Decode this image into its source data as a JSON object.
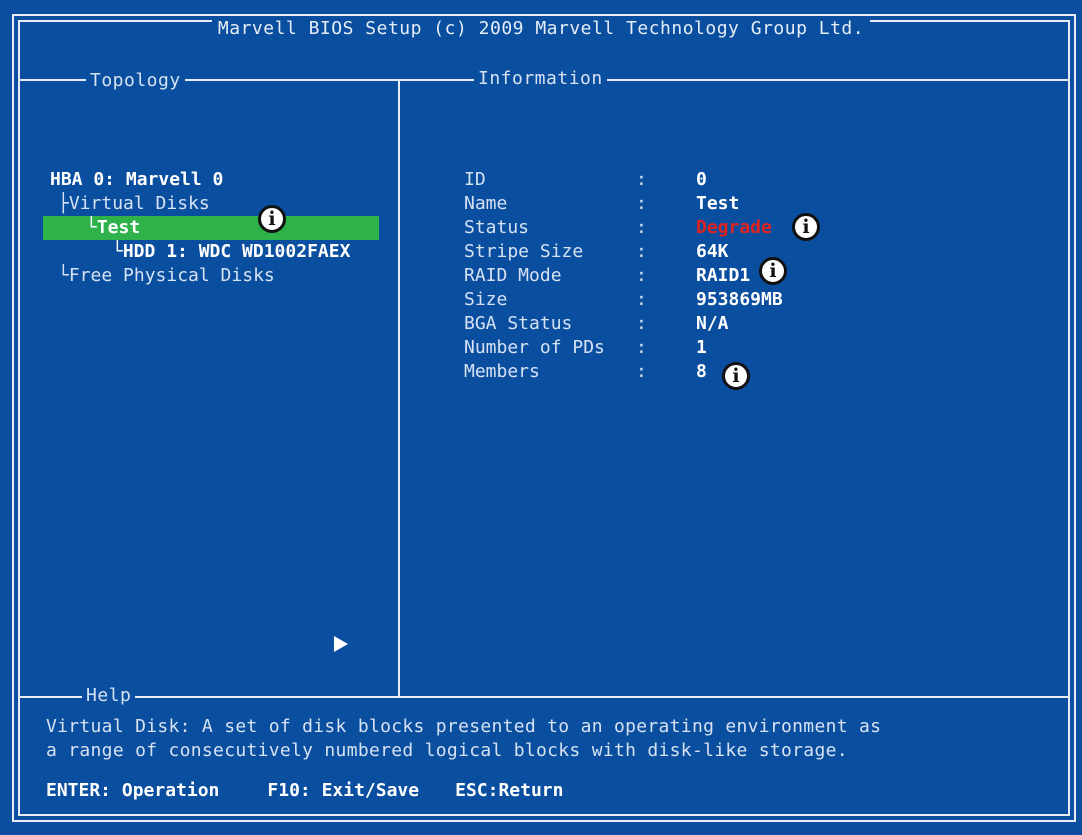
{
  "title": "Marvell BIOS Setup (c) 2009 Marvell Technology Group Ltd.",
  "panels": {
    "topology_label": "Topology",
    "information_label": "Information",
    "help_label": "Help"
  },
  "topology": {
    "hba": "HBA 0: Marvell 0",
    "virtual_disks": "Virtual Disks",
    "selected_vd": "Test",
    "hdd": "HDD 1: WDC WD1002FAEX",
    "free_disks": "Free Physical Disks",
    "selected_color": "#2fb24a"
  },
  "information": {
    "rows": [
      {
        "key": "ID",
        "value": "0"
      },
      {
        "key": "Name",
        "value": "Test"
      },
      {
        "key": "Status",
        "value": "Degrade"
      },
      {
        "key": "Stripe Size",
        "value": "64K"
      },
      {
        "key": "RAID Mode",
        "value": "RAID1"
      },
      {
        "key": "Size",
        "value": "953869MB"
      },
      {
        "key": "BGA Status",
        "value": "N/A"
      },
      {
        "key": "Number of PDs",
        "value": "1"
      },
      {
        "key": "Members",
        "value": "8"
      }
    ],
    "separator": ":",
    "status_color": "#e0231f"
  },
  "help": {
    "line1": "Virtual Disk: A set of disk blocks presented to an operating environment as",
    "line2": "a range of consecutively numbered logical blocks with disk-like storage."
  },
  "keys": {
    "enter": "ENTER: Operation",
    "f10": "F10: Exit/Save",
    "esc": "ESC:Return"
  },
  "annotation_icon": "i",
  "colors": {
    "background": "#0a4ea0",
    "frame": "#e6edf7",
    "text": "#d6e2f2"
  }
}
